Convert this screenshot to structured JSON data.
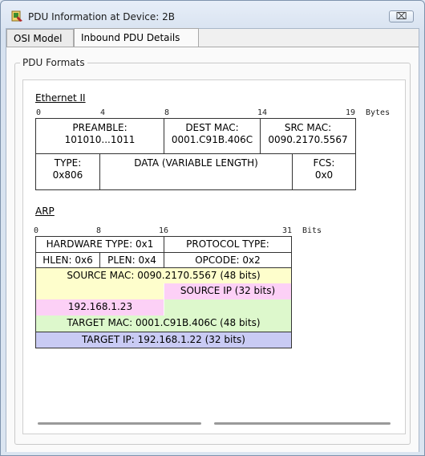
{
  "window": {
    "title": "PDU Information at Device: 2B",
    "close_label": "⌧"
  },
  "tabs": [
    {
      "label": "OSI Model"
    },
    {
      "label": "Inbound PDU Details"
    }
  ],
  "group": {
    "label": "PDU Formats"
  },
  "ethernet": {
    "title": "Ethernet II",
    "ticks": [
      "0",
      "4",
      "8",
      "14",
      "19"
    ],
    "unit": "Bytes",
    "preamble": {
      "label": "PREAMBLE:",
      "value": "101010...1011"
    },
    "dest_mac": {
      "label": "DEST MAC:",
      "value": "0001.C91B.406C"
    },
    "src_mac": {
      "label": "SRC MAC:",
      "value": "0090.2170.5567"
    },
    "type": {
      "label": "TYPE:",
      "value": "0x806"
    },
    "data": {
      "label": "DATA (VARIABLE LENGTH)"
    },
    "fcs": {
      "label": "FCS:",
      "value": "0x0"
    }
  },
  "arp": {
    "title": "ARP",
    "ticks": [
      "0",
      "8",
      "16",
      "31"
    ],
    "unit": "Bits",
    "hardware_type": "HARDWARE TYPE: 0x1",
    "protocol_type": "PROTOCOL TYPE:",
    "hlen": "HLEN: 0x6",
    "plen": "PLEN: 0x4",
    "opcode": "OPCODE: 0x2",
    "source_mac": "SOURCE MAC: 0090.2170.5567 (48 bits)",
    "source_ip_label": "SOURCE IP (32 bits)",
    "source_ip_value": "192.168.1.23",
    "target_mac": "TARGET MAC: 0001.C91B.406C (48 bits)",
    "target_ip": "TARGET IP: 192.168.1.22 (32 bits)"
  },
  "colors": {
    "source_mac": "#fefecc",
    "source_ip": "#fcd0f6",
    "target_mac": "#ddf8cc",
    "target_ip": "#c9cbf4"
  }
}
